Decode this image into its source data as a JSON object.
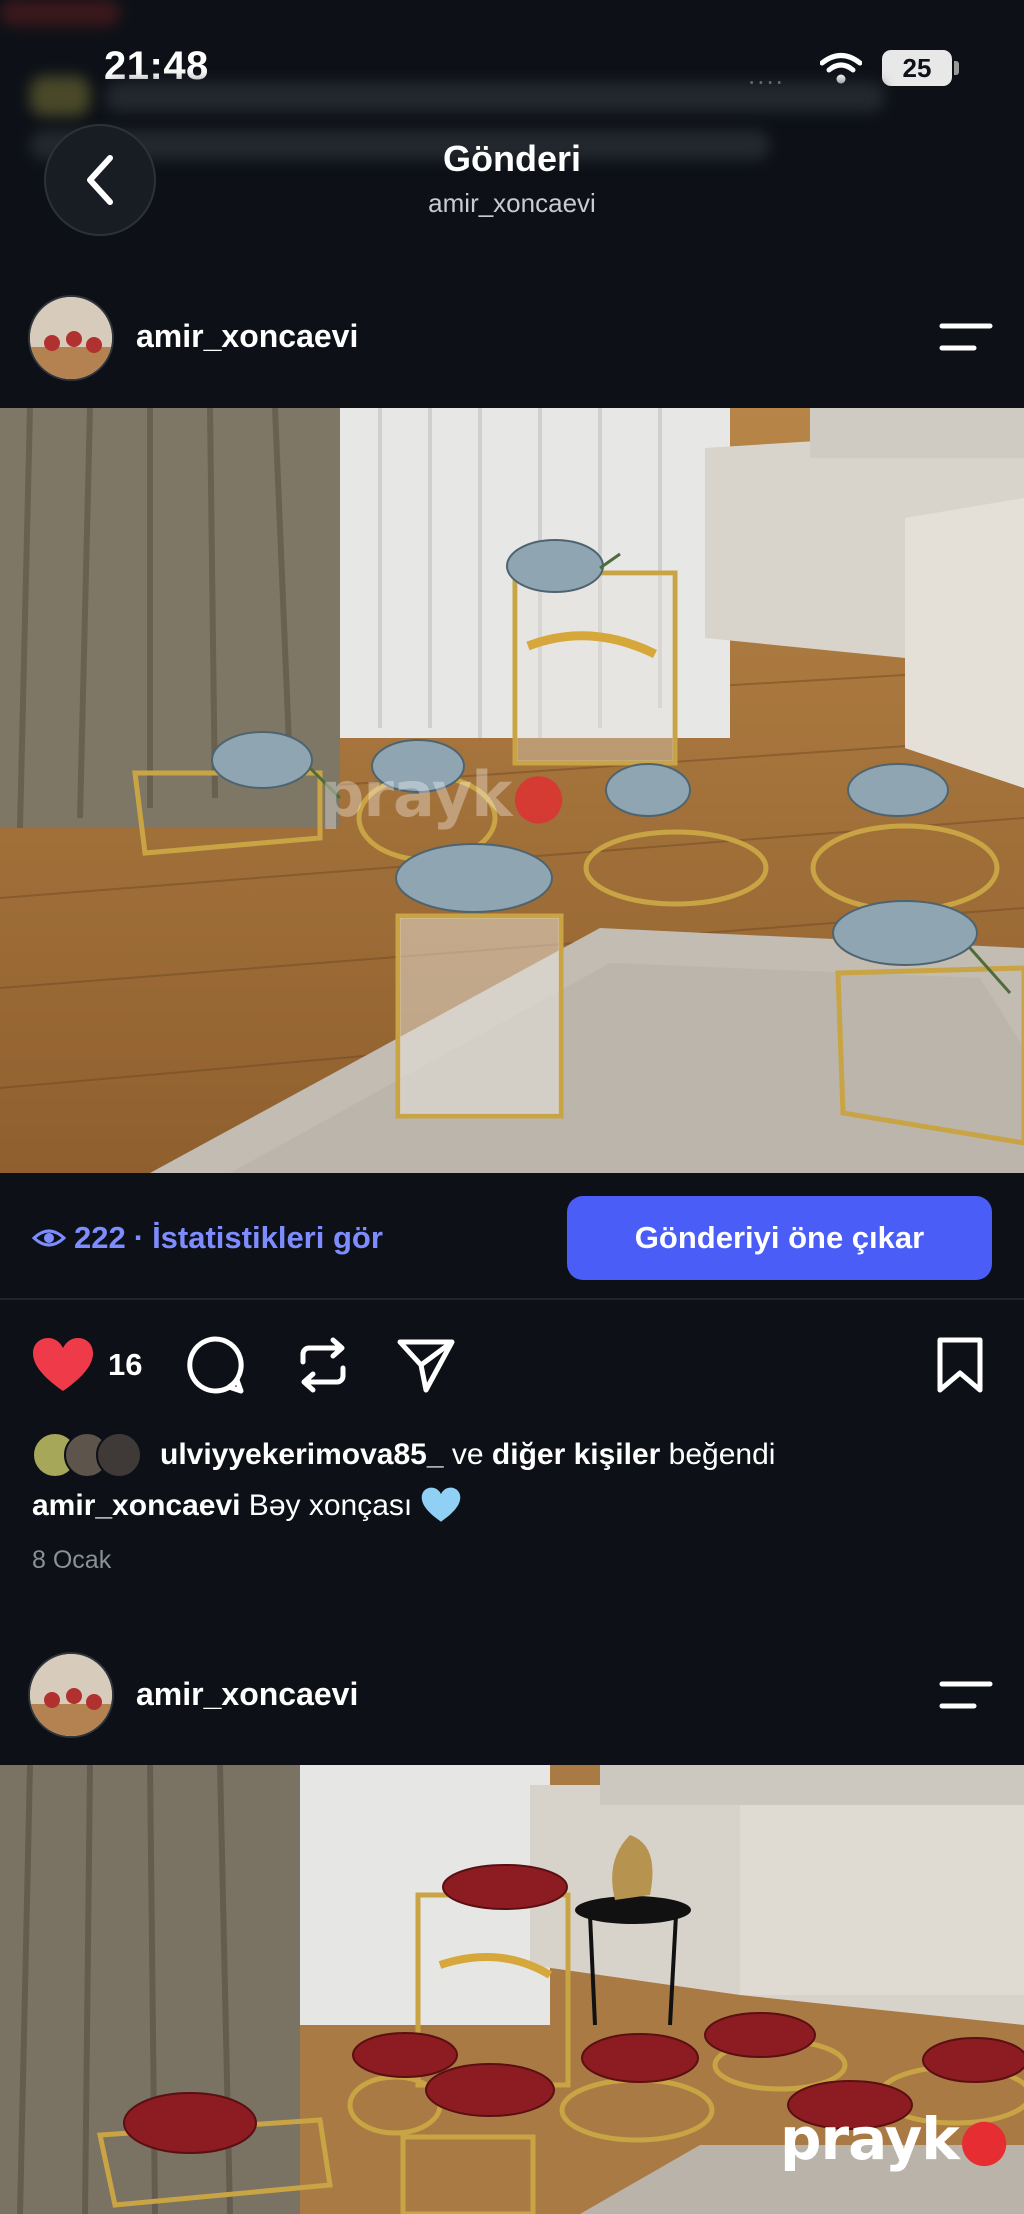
{
  "status_bar": {
    "time": "21:48",
    "signal_dots": "....",
    "battery": "25"
  },
  "header": {
    "title": "Gönderi",
    "subtitle": "amir_xoncaevi"
  },
  "posts": [
    {
      "username": "amir_xoncaevi",
      "image_alt": "Decorated glass boxes with blue flowers on wooden floor",
      "watermark": "prayk"
    },
    {
      "username": "amir_xoncaevi",
      "image_alt": "Decorated glass boxes with red flowers on wooden floor",
      "watermark": "prayk"
    }
  ],
  "insights": {
    "views": "222",
    "separator": "·",
    "label": "İstatistikleri gör",
    "promote_label": "Gönderiyi öne çıkar"
  },
  "actions": {
    "like_count": "16"
  },
  "likes": {
    "user": "ulviyyekerimova85_",
    "connector": " ve ",
    "others": "diğer kişiler",
    "suffix": " beğendi"
  },
  "caption": {
    "user": "amir_xoncaevi",
    "text": " Bəy xonçası"
  },
  "date": "8 Ocak",
  "colors": {
    "background": "#0d1117",
    "accent": "#4a5df7",
    "link": "#7d8dff",
    "like": "#ee3a49"
  }
}
